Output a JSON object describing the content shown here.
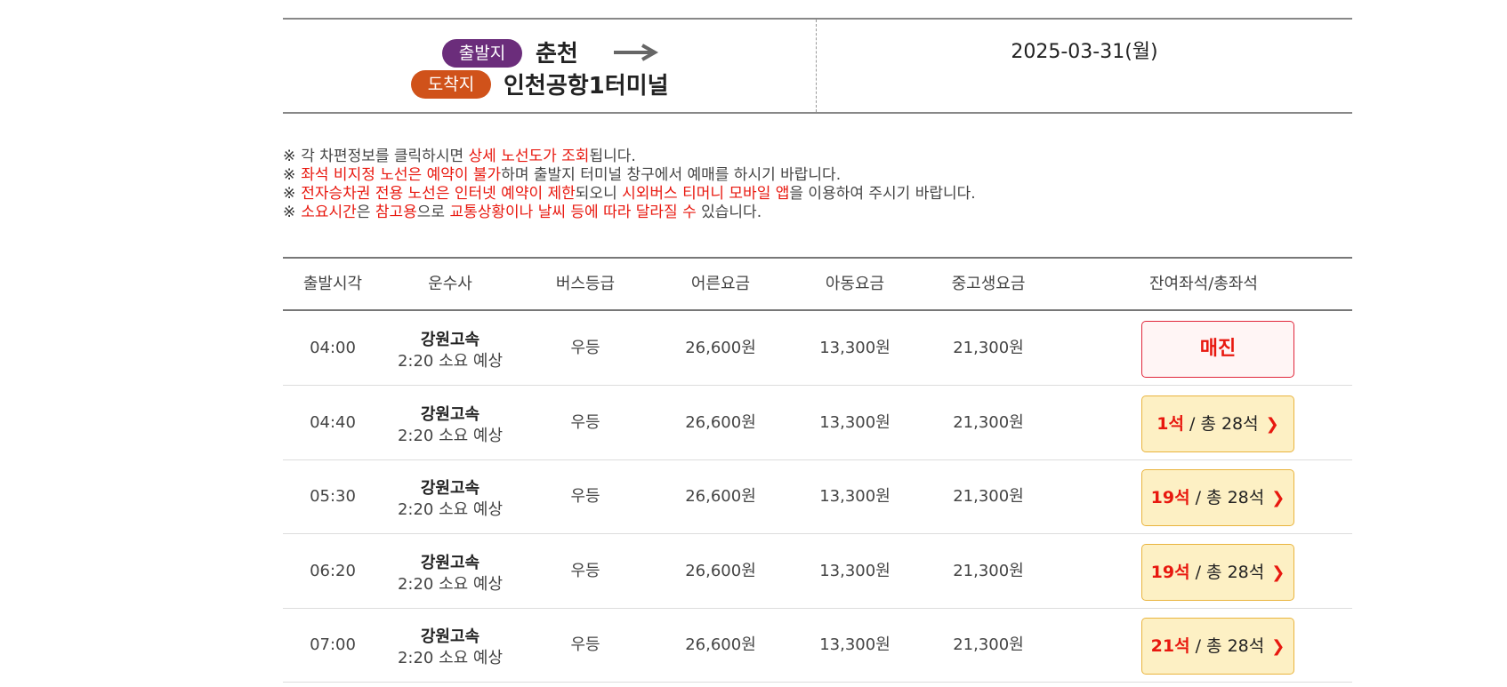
{
  "route": {
    "departure_badge": "출발지",
    "departure": "춘천",
    "arrival_badge": "도착지",
    "arrival": "인천공항1터미널",
    "date": "2025-03-31(월)"
  },
  "notices": [
    {
      "mark": "※",
      "parts": [
        {
          "text": "각 차편정보를 클릭하시면 ",
          "red": false
        },
        {
          "text": "상세 노선도가 조회",
          "red": true
        },
        {
          "text": "됩니다.",
          "red": false
        }
      ]
    },
    {
      "mark": "※",
      "parts": [
        {
          "text": "좌석 비지정 노선은 예약이 불가",
          "red": true
        },
        {
          "text": "하며 출발지 터미널 창구에서 예매를 하시기 바랍니다.",
          "red": false
        }
      ]
    },
    {
      "mark": "※",
      "parts": [
        {
          "text": "전자승차권 전용 노선은 인터넷 예약이 제한",
          "red": true
        },
        {
          "text": "되오니 ",
          "red": false
        },
        {
          "text": "시외버스 티머니 모바일 앱",
          "red": true
        },
        {
          "text": "을 이용하여 주시기 바랍니다.",
          "red": false
        }
      ]
    },
    {
      "mark": "※",
      "parts": [
        {
          "text": "소요시간",
          "red": true
        },
        {
          "text": "은 ",
          "red": false
        },
        {
          "text": "참고용",
          "red": true
        },
        {
          "text": "으로 ",
          "red": false
        },
        {
          "text": "교통상황이나 날씨 등에 따라 달라질 수",
          "red": true
        },
        {
          "text": " 있습니다.",
          "red": false
        }
      ]
    }
  ],
  "table": {
    "headers": [
      "출발시각",
      "운수사",
      "버스등급",
      "어른요금",
      "아동요금",
      "중고생요금",
      "잔여좌석/총좌석"
    ],
    "rows": [
      {
        "time": "04:00",
        "company": "강원고속",
        "duration": "2:20 소요 예상",
        "grade": "우등",
        "adult": "26,600원",
        "child": "13,300원",
        "student": "21,300원",
        "status": "soldout",
        "seat_label": "매진"
      },
      {
        "time": "04:40",
        "company": "강원고속",
        "duration": "2:20 소요 예상",
        "grade": "우등",
        "adult": "26,600원",
        "child": "13,300원",
        "student": "21,300원",
        "status": "available",
        "remaining": "1석",
        "total": " / 총 28석"
      },
      {
        "time": "05:30",
        "company": "강원고속",
        "duration": "2:20 소요 예상",
        "grade": "우등",
        "adult": "26,600원",
        "child": "13,300원",
        "student": "21,300원",
        "status": "available",
        "remaining": "19석",
        "total": " / 총 28석"
      },
      {
        "time": "06:20",
        "company": "강원고속",
        "duration": "2:20 소요 예상",
        "grade": "우등",
        "adult": "26,600원",
        "child": "13,300원",
        "student": "21,300원",
        "status": "available",
        "remaining": "19석",
        "total": " / 총 28석"
      },
      {
        "time": "07:00",
        "company": "강원고속",
        "duration": "2:20 소요 예상",
        "grade": "우등",
        "adult": "26,600원",
        "child": "13,300원",
        "student": "21,300원",
        "status": "available",
        "remaining": "21석",
        "total": " / 총 28석"
      }
    ]
  },
  "colors": {
    "departure_badge": "#6b2d7b",
    "arrival_badge": "#d0521a",
    "highlight_red": "#e8180f",
    "seat_available_bg": "#fdf0c4",
    "seat_available_border": "#e9b43e",
    "soldout_border": "#e0273b"
  },
  "icons": {
    "route_arrow": "arrow-right-icon",
    "seat_chevron": "chevron-right-icon"
  }
}
